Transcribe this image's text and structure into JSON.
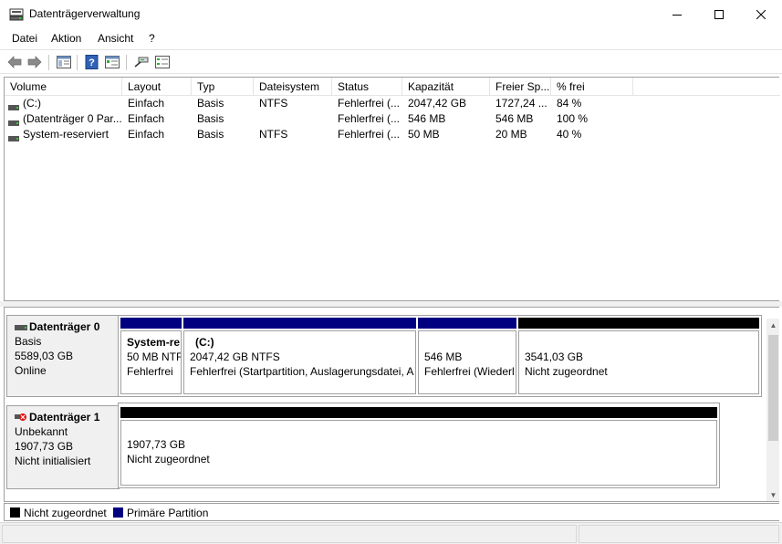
{
  "window": {
    "title": "Datenträgerverwaltung",
    "icon": "disk-management-icon"
  },
  "menu": [
    {
      "label": "Datei"
    },
    {
      "label": "Aktion"
    },
    {
      "label": "Ansicht"
    },
    {
      "label": "?"
    }
  ],
  "toolbar": {
    "buttons": [
      "back-icon",
      "forward-icon",
      "show-hide-tree-icon",
      "help-icon",
      "properties-icon",
      "connect-icon",
      "list-view-icon"
    ]
  },
  "volumes": {
    "headers": [
      "Volume",
      "Layout",
      "Typ",
      "Dateisystem",
      "Status",
      "Kapazität",
      "Freier Sp...",
      "% frei"
    ],
    "rows": [
      [
        "(C:)",
        "Einfach",
        "Basis",
        "NTFS",
        "Fehlerfrei (...",
        "2047,42 GB",
        "1727,24 ...",
        "84 %"
      ],
      [
        "(Datenträger 0 Par...",
        "Einfach",
        "Basis",
        "",
        "Fehlerfrei (...",
        "546 MB",
        "546 MB",
        "100 %"
      ],
      [
        "System-reserviert",
        "Einfach",
        "Basis",
        "NTFS",
        "Fehlerfrei (...",
        "50 MB",
        "20 MB",
        "40 %"
      ]
    ]
  },
  "disks": [
    {
      "name": "Datenträger 0",
      "type": "Basis",
      "size": "5589,03 GB",
      "state": "Online",
      "partitions": [
        {
          "title": "System-re",
          "line1": "50 MB NTF",
          "line2": "Fehlerfrei",
          "kind": "primary"
        },
        {
          "title": "(C:)",
          "line1": "2047,42 GB NTFS",
          "line2": "Fehlerfrei (Startpartition, Auslagerungsdatei, A",
          "kind": "primary"
        },
        {
          "title": "",
          "line1": "546 MB",
          "line2": "Fehlerfrei (Wiederl",
          "kind": "primary"
        },
        {
          "title": "",
          "line1": "3541,03 GB",
          "line2": "Nicht zugeordnet",
          "kind": "unallocated"
        }
      ]
    },
    {
      "name": "Datenträger 1",
      "type": "Unbekannt",
      "size": "1907,73 GB",
      "state": "Nicht initialisiert",
      "partitions": [
        {
          "title": "",
          "line1": "1907,73 GB",
          "line2": "Nicht zugeordnet",
          "kind": "unallocated"
        }
      ]
    }
  ],
  "legend": [
    {
      "label": "Nicht zugeordnet",
      "color": "#000000"
    },
    {
      "label": "Primäre Partition",
      "color": "#000080"
    }
  ],
  "colors": {
    "primary": "#000080",
    "unallocated": "#000000"
  }
}
